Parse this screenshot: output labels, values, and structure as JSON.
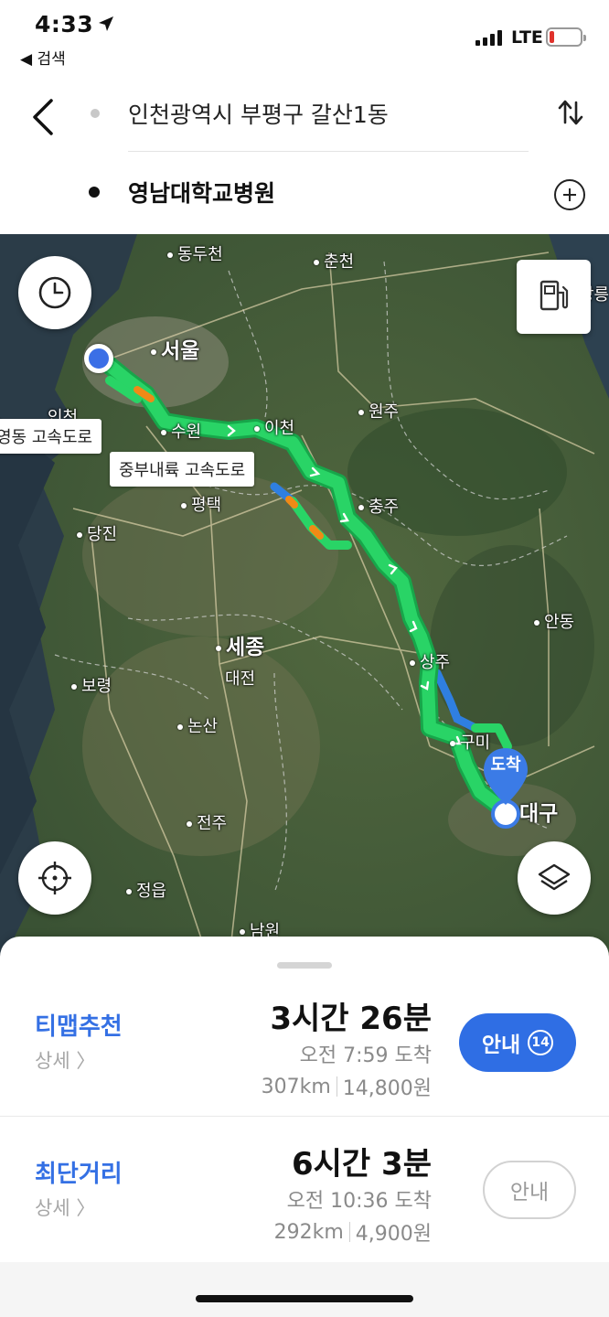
{
  "status_bar": {
    "time": "4:33",
    "back_app": "◀ 검색",
    "network": "LTE"
  },
  "search": {
    "origin": "인천광역시 부평구 갈산1동",
    "destination": "영남대학교병원"
  },
  "map": {
    "cities": {
      "dongducheon": "동두천",
      "chuncheon": "춘천",
      "seoul": "서울",
      "gangneung": "강릉",
      "wonju": "원주",
      "incheon": "인천",
      "suwon": "수원",
      "icheon": "이천",
      "chungju": "충주",
      "pyeongtaek": "평택",
      "dangjin": "당진",
      "andong": "안동",
      "sejong": "세종",
      "daejeon": "대전",
      "sangju": "상주",
      "boryeong": "보령",
      "nonsan": "논산",
      "gumi": "구미",
      "daegu": "대구",
      "jeonju": "전주",
      "jeongeup": "정읍",
      "namwon": "남원"
    },
    "highways": {
      "yeongdong": "영동 고속도로",
      "jungbu_naeryuk": "중부내륙 고속도로"
    },
    "arrive_label": "도착"
  },
  "routes": [
    {
      "name": "티맵추천",
      "detail": "상세 〉",
      "duration": "3시간 26분",
      "arrival": "오전 7:59 도착",
      "distance": "307km",
      "toll": "14,800원",
      "guide_label": "안내",
      "guide_badge": "14"
    },
    {
      "name": "최단거리",
      "detail": "상세 〉",
      "duration": "6시간 3분",
      "arrival": "오전 10:36 도착",
      "distance": "292km",
      "toll": "4,900원",
      "guide_label": "안내"
    }
  ],
  "colors": {
    "accent": "#2f6ee4",
    "route": "#1fc75a",
    "traffic_slow": "#f08a16",
    "traffic_alt": "#2f7fe0"
  },
  "icons": {
    "history": "clock-icon",
    "fuel": "gas-station-icon",
    "locate": "crosshair-icon",
    "layers": "layers-icon",
    "swap": "swap-vertical-icon",
    "add": "plus-circle-icon",
    "back": "chevron-left-icon"
  }
}
